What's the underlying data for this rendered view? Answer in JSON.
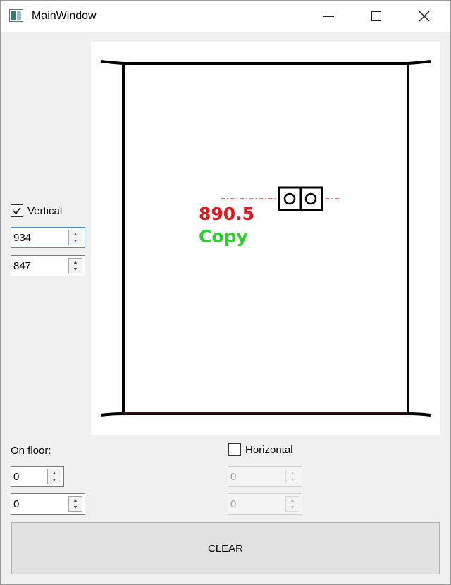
{
  "window": {
    "title": "MainWindow"
  },
  "canvas": {
    "measure_value": "890.5",
    "copy_label": "Copy",
    "measure_color": "#e0191c",
    "copy_color": "#2ad12a"
  },
  "vertical": {
    "label": "Vertical",
    "checked": true,
    "value_1": "934",
    "value_2": "847"
  },
  "on_floor": {
    "label": "On floor:",
    "value_1": "0",
    "value_2": "0"
  },
  "horizontal": {
    "label": "Horizontal",
    "checked": false,
    "value_1": "0",
    "value_2": "0"
  },
  "clear_button": {
    "label": "CLEAR"
  }
}
